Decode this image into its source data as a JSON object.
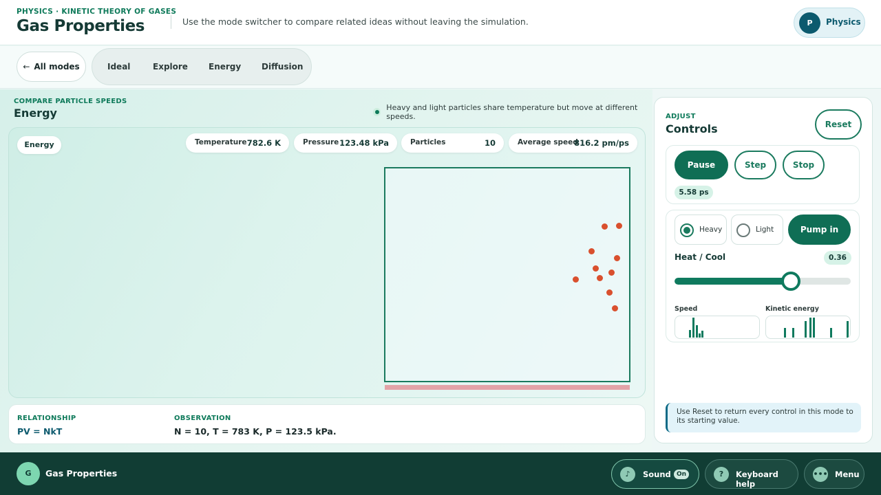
{
  "header": {
    "eyebrow": "PHYSICS · KINETIC THEORY OF GASES",
    "title": "Gas Properties",
    "subtitle": "Use the mode switcher to compare related ideas without leaving the simulation.",
    "profile": {
      "initial": "P",
      "label": "Physics"
    }
  },
  "modebar": {
    "back_label": "All modes",
    "tabs": [
      {
        "label": "Ideal"
      },
      {
        "label": "Explore"
      },
      {
        "label": "Energy"
      },
      {
        "label": "Diffusion"
      }
    ]
  },
  "main": {
    "eyebrow": "COMPARE PARTICLE SPEEDS",
    "title": "Energy",
    "note": "Heavy and light particles share temperature but move at different speeds.",
    "chip": "Energy",
    "stats": [
      {
        "label": "Temperature",
        "value": "782.6 K"
      },
      {
        "label": "Pressure",
        "value": "123.48 kPa"
      },
      {
        "label": "Particles",
        "value": "10"
      },
      {
        "label": "Average speed",
        "value": "816.2 pm/ps"
      }
    ]
  },
  "relationship": {
    "label": "RELATIONSHIP",
    "value": "PV = NkT",
    "observation_label": "OBSERVATION",
    "observation": "N = 10, T = 783 K, P = 123.5 kPa."
  },
  "controls": {
    "eyebrow": "ADJUST",
    "title": "Controls",
    "reset": "Reset",
    "pause": "Pause",
    "step": "Step",
    "stop": "Stop",
    "time": "5.58 ps",
    "species": [
      {
        "label": "Heavy",
        "selected": true
      },
      {
        "label": "Light",
        "selected": false
      }
    ],
    "pump": "Pump in",
    "heat_label": "Heat / Cool",
    "heat_value": "0.36",
    "heat_level": 0.66,
    "speed_label": "Speed",
    "ke_label": "Kinetic energy",
    "tip": "Use Reset to return every control in this mode to its starting value."
  },
  "footer": {
    "logo": "G",
    "app_name": "Gas Properties",
    "sound_label": "Sound",
    "sound_state": "On",
    "help_label": "Keyboard help",
    "help_icon": "?",
    "menu_label": "Menu"
  },
  "colors": {
    "accent": "#0f6e55",
    "particle": "#d9502e",
    "footer": "#113d34"
  }
}
